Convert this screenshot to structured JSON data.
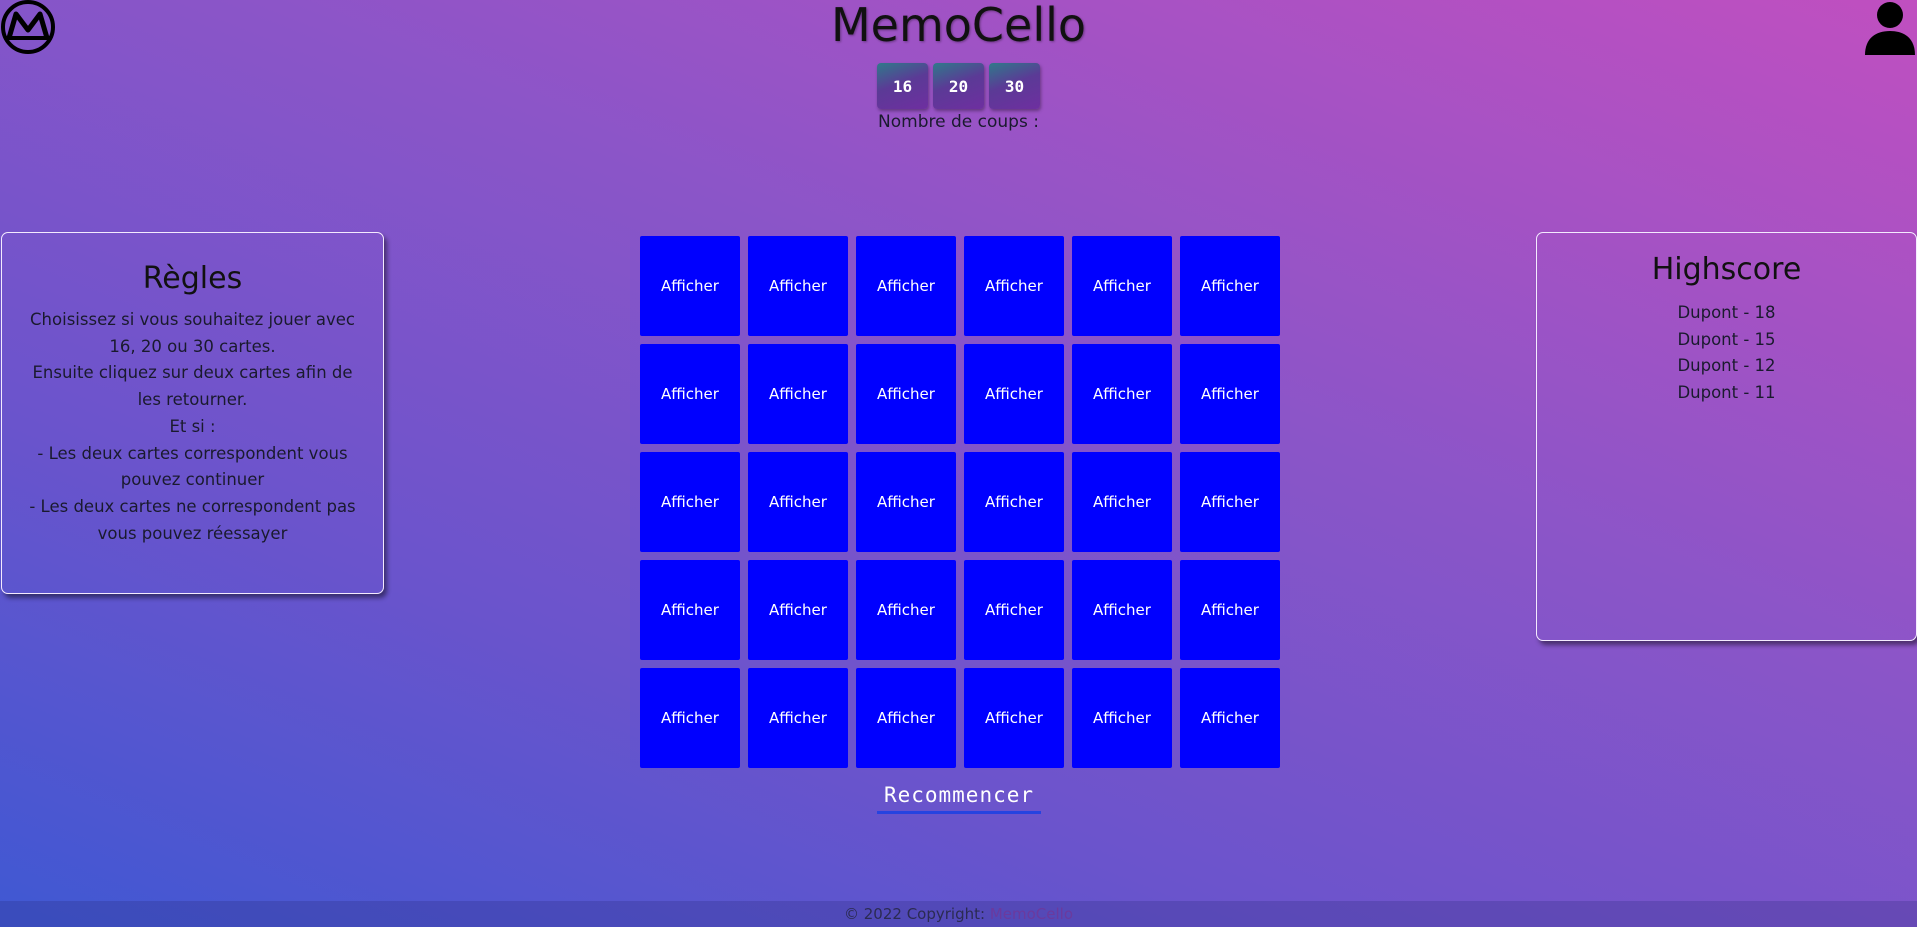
{
  "header": {
    "title": "MemoCello",
    "logo_icon": "memocello-logo-icon",
    "user_icon": "user-icon"
  },
  "size_options": [
    "16",
    "20",
    "30"
  ],
  "moves_label": "Nombre de coups :",
  "rules": {
    "title": "Règles",
    "lines": [
      "Choisissez si vous souhaitez jouer avec 16, 20 ou 30 cartes.",
      "Ensuite cliquez sur deux cartes afin de les retourner.",
      "Et si :",
      "- Les deux cartes correspondent vous pouvez continuer",
      "- Les deux cartes ne correspondent pas vous pouvez réessayer"
    ]
  },
  "highscore": {
    "title": "Highscore",
    "entries": [
      "Dupont - 18",
      "Dupont - 15",
      "Dupont - 12",
      "Dupont - 11"
    ]
  },
  "board": {
    "columns": 6,
    "rows": 5,
    "card_label": "Afficher",
    "card_color": "#0000ff"
  },
  "restart_label": "Recommencer",
  "footer": {
    "copyright": "© 2022 Copyright:",
    "link": "MemoCello"
  },
  "colors": {
    "gradient_start": "#3f58d3",
    "gradient_end": "#c04fc0",
    "restart_underline": "#2643e0"
  }
}
